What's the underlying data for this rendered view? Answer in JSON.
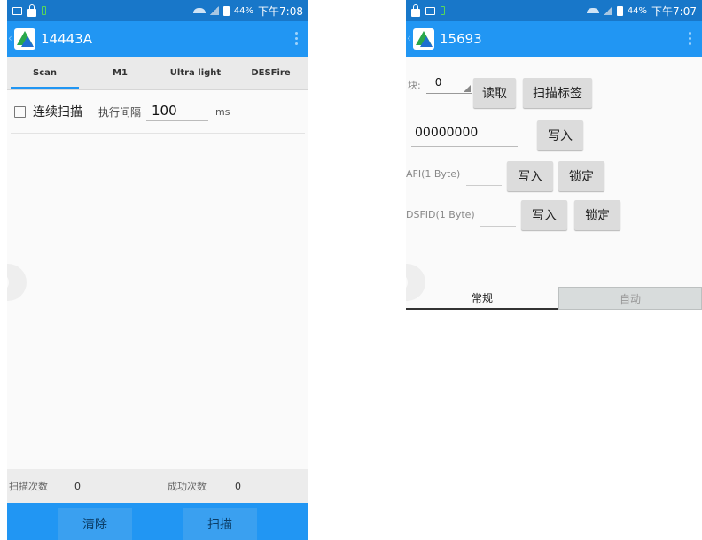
{
  "colors": {
    "statusbar": "#1877c9",
    "appbar": "#2196f3",
    "accent": "#2196f3",
    "tab_bg": "#eaeaea",
    "button_grey": "#dcdcdc"
  },
  "left": {
    "status": {
      "battery_pct": "44%",
      "time": "下午7:08"
    },
    "app_title": "14443A",
    "tabs": [
      "Scan",
      "M1",
      "Ultra light",
      "DESFire"
    ],
    "active_tab": "Scan",
    "continuous_label": "连续扫描",
    "continuous_checked": false,
    "interval_label": "执行间隔",
    "interval_value": "100",
    "interval_unit": "ms",
    "scan_count_label": "扫描次数",
    "scan_count_value": "0",
    "success_count_label": "成功次数",
    "success_count_value": "0",
    "clear_button": "清除",
    "scan_button": "扫描"
  },
  "right": {
    "status": {
      "battery_pct": "44%",
      "time": "下午7:07"
    },
    "app_title": "15693",
    "block_label": "块:",
    "block_value": "0",
    "read_button": "读取",
    "scan_tag_button": "扫描标签",
    "data_value": "00000000",
    "write_button": "写入",
    "afi_label": "AFI(1 Byte)",
    "afi_write_button": "写入",
    "afi_lock_button": "锁定",
    "dsfid_label": "DSFID(1 Byte)",
    "dsfid_write_button": "写入",
    "dsfid_lock_button": "锁定",
    "mode_regular": "常规",
    "mode_auto": "自动"
  }
}
